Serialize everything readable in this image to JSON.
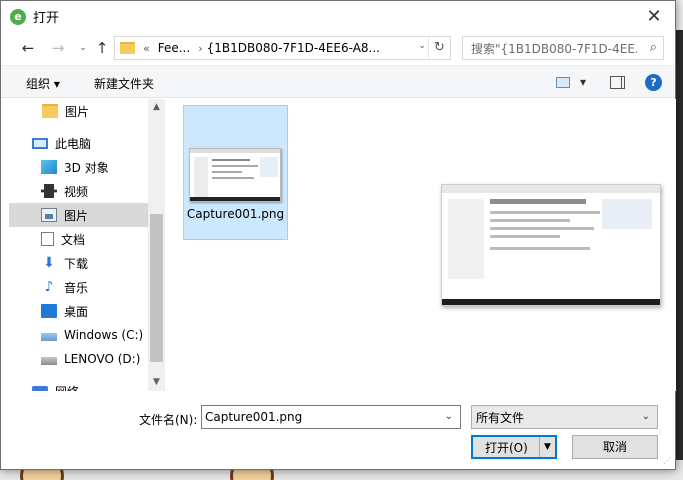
{
  "window": {
    "title": "打开",
    "close_symbol": "✕"
  },
  "nav": {
    "back": "←",
    "forward": "→",
    "recent": "⌄",
    "up": "↑"
  },
  "address": {
    "overflow": "«",
    "crumbs": [
      "Fee...",
      "{1B1DB080-7F1D-4EE6-A8..."
    ],
    "crumb_sep": "›",
    "dropdown": "⌄",
    "refresh": "↻"
  },
  "search": {
    "placeholder": "搜索\"{1B1DB080-7F1D-4EE...",
    "icon": "⌕"
  },
  "toolbar": {
    "organize": "组织 ▾",
    "new_folder": "新建文件夹",
    "view_dropdown": "▾",
    "help": "?"
  },
  "sidebar": {
    "items": [
      {
        "label": "图片",
        "icon": "folder-icon"
      },
      {
        "label": "此电脑",
        "icon": "computer-icon"
      },
      {
        "label": "3D 对象",
        "icon": "3d-objects-icon"
      },
      {
        "label": "视频",
        "icon": "video-icon"
      },
      {
        "label": "图片",
        "icon": "pictures-icon",
        "selected": true
      },
      {
        "label": "文档",
        "icon": "documents-icon"
      },
      {
        "label": "下载",
        "icon": "downloads-icon"
      },
      {
        "label": "音乐",
        "icon": "music-icon"
      },
      {
        "label": "桌面",
        "icon": "desktop-icon"
      },
      {
        "label": "Windows (C:)",
        "icon": "windows-drive-icon"
      },
      {
        "label": "LENOVO (D:)",
        "icon": "drive-icon"
      },
      {
        "label": "网络",
        "icon": "network-icon"
      }
    ],
    "scroll_up": "▲",
    "scroll_down": "▼"
  },
  "files": [
    {
      "name": "Capture001.png",
      "selected": true
    }
  ],
  "footer": {
    "filename_label": "文件名(N):",
    "filename_value": "Capture001.png",
    "filetype_value": "所有文件",
    "open_label": "打开(O)",
    "cancel_label": "取消",
    "chevron": "⌄"
  }
}
